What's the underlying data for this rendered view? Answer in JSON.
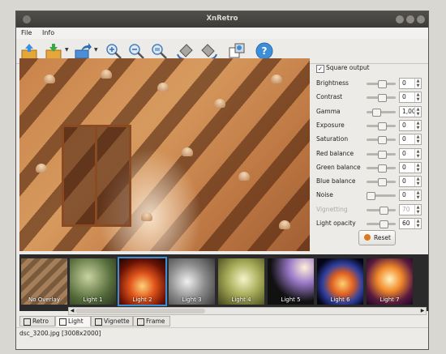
{
  "window": {
    "title": "XnRetro"
  },
  "menu": [
    {
      "label": "File"
    },
    {
      "label": "Info"
    }
  ],
  "toolbar": {
    "buttons": [
      {
        "name": "open-icon"
      },
      {
        "name": "save-icon"
      },
      {
        "name": "share-icon"
      },
      {
        "name": "zoom-in-icon"
      },
      {
        "name": "zoom-out-icon"
      },
      {
        "name": "zoom-fit-icon"
      },
      {
        "name": "rotate-left-icon"
      },
      {
        "name": "rotate-right-icon"
      },
      {
        "name": "compare-icon"
      },
      {
        "name": "help-icon"
      }
    ]
  },
  "controls": {
    "square_output": {
      "label": "Square output",
      "checked": true
    },
    "rows": [
      {
        "label": "Brightness",
        "value": "0",
        "fraction": 0.5,
        "enabled": true
      },
      {
        "label": "Contrast",
        "value": "0",
        "fraction": 0.5,
        "enabled": true
      },
      {
        "label": "Gamma",
        "value": "1,00",
        "fraction": 0.25,
        "enabled": true
      },
      {
        "label": "Exposure",
        "value": "0",
        "fraction": 0.5,
        "enabled": true
      },
      {
        "label": "Saturation",
        "value": "0",
        "fraction": 0.5,
        "enabled": true
      },
      {
        "label": "Red balance",
        "value": "0",
        "fraction": 0.5,
        "enabled": true
      },
      {
        "label": "Green balance",
        "value": "0",
        "fraction": 0.5,
        "enabled": true
      },
      {
        "label": "Blue balance",
        "value": "0",
        "fraction": 0.5,
        "enabled": true
      },
      {
        "label": "Noise",
        "value": "0",
        "fraction": 0.0,
        "enabled": true
      },
      {
        "label": "Vignetting",
        "value": "70",
        "fraction": 0.6,
        "enabled": false
      },
      {
        "label": "Light opacity",
        "value": "60",
        "fraction": 0.6,
        "enabled": true
      }
    ],
    "reset_label": "Reset"
  },
  "thumbnails": [
    {
      "label": "No Overlay",
      "style": "none"
    },
    {
      "label": "Light 1",
      "style": "l1"
    },
    {
      "label": "Light 2",
      "style": "l2",
      "selected": true
    },
    {
      "label": "Light 3",
      "style": "l3"
    },
    {
      "label": "Light 4",
      "style": "l4"
    },
    {
      "label": "Light 5",
      "style": "l5"
    },
    {
      "label": "Light 6",
      "style": "l6"
    },
    {
      "label": "Light 7",
      "style": "l7"
    }
  ],
  "tabs": [
    {
      "label": "Retro",
      "active": false
    },
    {
      "label": "Light",
      "active": true
    },
    {
      "label": "Vignette",
      "active": false
    },
    {
      "label": "Frame",
      "active": false
    }
  ],
  "status": {
    "text": "dsc_3200.jpg [3008x2000]"
  },
  "colors": {
    "accent": "#3c8ed6",
    "titlebar": "#3d3c38"
  }
}
